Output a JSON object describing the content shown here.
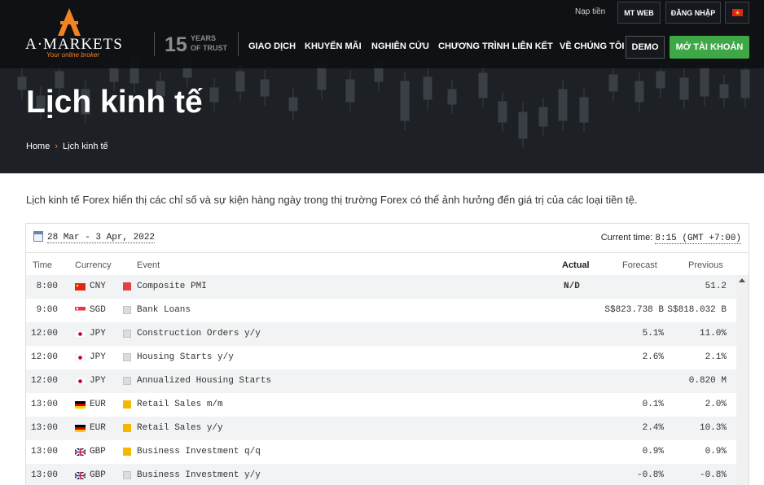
{
  "header": {
    "logo_letter": "A",
    "logo_text": "A·MARKETS",
    "logo_tagline": "Your online broker",
    "trust_number": "15",
    "trust_years": "YEARS",
    "trust_of": "OF TRUST",
    "deposit_label": "Nạp tiền",
    "mtweb_label": "MT WEB",
    "login_label": "ĐĂNG NHẬP",
    "nav": [
      "GIAO DỊCH",
      "KHUYẾN MÃI",
      "NGHIÊN CỨU",
      "CHƯƠNG TRÌNH LIÊN KẾT",
      "VỀ CHÚNG TÔI"
    ],
    "demo_label": "DEMO",
    "open_account_label": "MỞ TÀI KHOẢN",
    "brand_color": "#f58220",
    "accent_green": "#3fa846"
  },
  "hero": {
    "title": "Lịch kinh tế",
    "breadcrumb": [
      "Home",
      "Lịch kinh tế"
    ]
  },
  "intro": "Lịch kinh tế Forex hiển thị các chỉ số và sự kiện hàng ngày trong thị trường Forex có thể ảnh hưởng đến giá trị của các loại tiền tệ.",
  "calendar": {
    "date_range": "28 Mar - 3 Apr, 2022",
    "current_time_label": "Current time:",
    "current_time_value": "8:15 (GMT +7:00)",
    "columns": {
      "time": "Time",
      "currency": "Currency",
      "event": "Event",
      "actual": "Actual",
      "forecast": "Forecast",
      "previous": "Previous"
    },
    "rows": [
      {
        "time": "8:00",
        "flag": "cn-flag-icon",
        "currency": "CNY",
        "importance": "high",
        "event": "Composite PMI",
        "actual": "N/D",
        "forecast": "",
        "previous": "51.2"
      },
      {
        "time": "9:00",
        "flag": "sg-flag-icon",
        "currency": "SGD",
        "importance": "low",
        "event": "Bank Loans",
        "actual": "",
        "forecast": "S$823.738 B",
        "previous": "S$818.032 B"
      },
      {
        "time": "12:00",
        "flag": "jp-flag-icon",
        "currency": "JPY",
        "importance": "low",
        "event": "Construction Orders y/y",
        "actual": "",
        "forecast": "5.1%",
        "previous": "11.0%"
      },
      {
        "time": "12:00",
        "flag": "jp-flag-icon",
        "currency": "JPY",
        "importance": "low",
        "event": "Housing Starts y/y",
        "actual": "",
        "forecast": "2.6%",
        "previous": "2.1%"
      },
      {
        "time": "12:00",
        "flag": "jp-flag-icon",
        "currency": "JPY",
        "importance": "low",
        "event": "Annualized Housing Starts",
        "actual": "",
        "forecast": "",
        "previous": "0.820 M"
      },
      {
        "time": "13:00",
        "flag": "de-flag-icon",
        "currency": "EUR",
        "importance": "medium",
        "event": "Retail Sales m/m",
        "actual": "",
        "forecast": "0.1%",
        "previous": "2.0%"
      },
      {
        "time": "13:00",
        "flag": "de-flag-icon",
        "currency": "EUR",
        "importance": "medium",
        "event": "Retail Sales y/y",
        "actual": "",
        "forecast": "2.4%",
        "previous": "10.3%"
      },
      {
        "time": "13:00",
        "flag": "gb-flag-icon",
        "currency": "GBP",
        "importance": "medium",
        "event": "Business Investment q/q",
        "actual": "",
        "forecast": "0.9%",
        "previous": "0.9%"
      },
      {
        "time": "13:00",
        "flag": "gb-flag-icon",
        "currency": "GBP",
        "importance": "low",
        "event": "Business Investment y/y",
        "actual": "",
        "forecast": "-0.8%",
        "previous": "-0.8%"
      }
    ],
    "importance_colors": {
      "high": "#e2404b",
      "medium": "#f5b800",
      "low": "#dcdcdc"
    }
  }
}
